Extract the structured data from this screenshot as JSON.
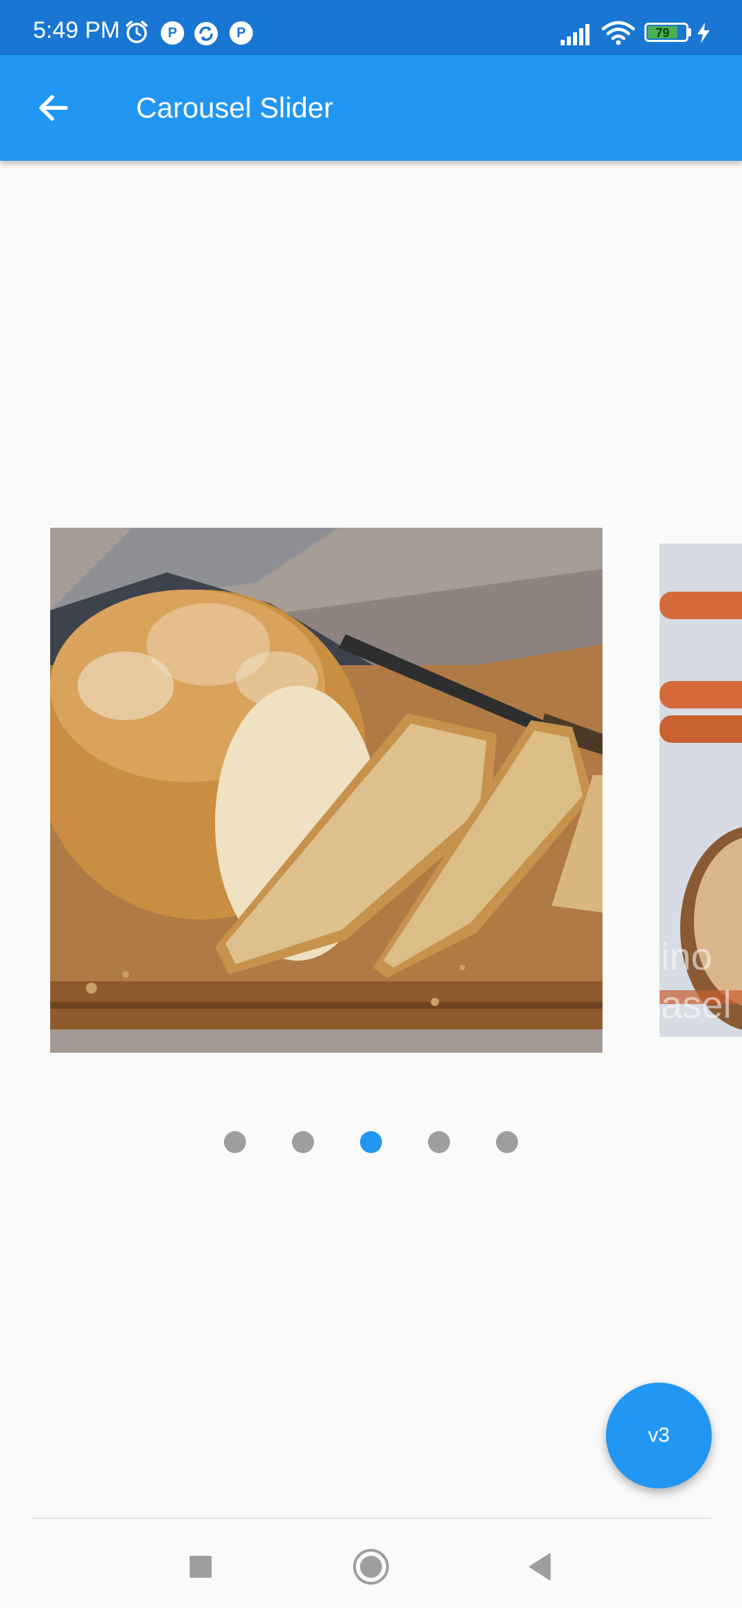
{
  "status_bar": {
    "time": "5:49 PM",
    "battery_level": "79",
    "icons": [
      "alarm-icon",
      "notification-p-icon",
      "sync-icon",
      "notification-p-icon",
      "signal-icon",
      "wifi-icon",
      "battery-icon",
      "charging-icon"
    ]
  },
  "app_bar": {
    "title": "Carousel Slider",
    "back_icon": "arrow-left-icon"
  },
  "carousel": {
    "slide_count": 5,
    "active_index": 2,
    "slides": [
      {
        "subject": "bread-loaf-image"
      },
      {
        "subject": "dessert-board-image"
      }
    ],
    "colors": {
      "dot_active": "#2196f3",
      "dot_inactive": "#9e9e9e"
    }
  },
  "fab": {
    "label": "v3"
  },
  "nav_bar": {
    "buttons": [
      "recents-icon",
      "home-icon",
      "back-icon"
    ]
  },
  "colors": {
    "primary": "#2196f3",
    "status_bar": "#1976d2",
    "background": "#fafafa"
  }
}
